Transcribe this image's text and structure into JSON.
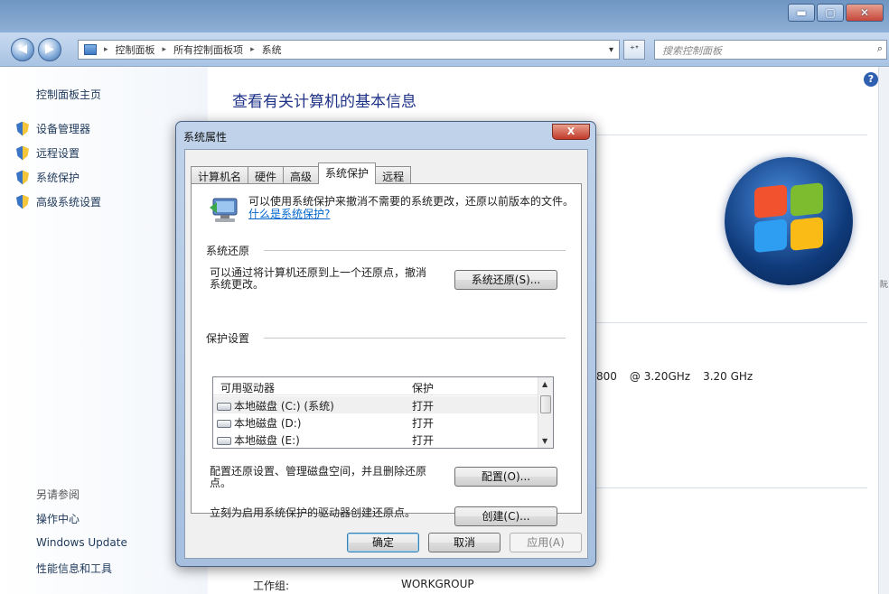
{
  "window": {
    "minimize_glyph": "▬",
    "maximize_glyph": "▢",
    "close_glyph": "✕"
  },
  "address_bar": {
    "back_glyph": "◀",
    "forward_glyph": "▶",
    "crumbs": [
      "控制面板",
      "所有控制面板项",
      "系统"
    ],
    "crumb_separator": "▸",
    "dropdown_glyph": "▾",
    "refresh_glyph": "⁺ᐩ",
    "search_placeholder": "搜索控制面板",
    "search_glyph": "⌕"
  },
  "sidebar": {
    "home": "控制面板主页",
    "tasks": [
      "设备管理器",
      "远程设置",
      "系统保护",
      "高级系统设置"
    ],
    "see_also_title": "另请参阅",
    "see_also": [
      "操作中心",
      "Windows Update",
      "性能信息和工具"
    ]
  },
  "main": {
    "title": "查看有关计算机的基本信息",
    "help_glyph": "?",
    "cpu_model_tail": "800",
    "cpu_speed": "@ 3.20GHz",
    "cpu_speed2": "3.20 GHz",
    "workgroup_label": "工作组:",
    "workgroup_value": "WORKGROUP",
    "edge_glyph": "阮"
  },
  "dialog": {
    "title": "系统属性",
    "close_glyph": "X",
    "tabs": [
      "计算机名",
      "硬件",
      "高级",
      "系统保护",
      "远程"
    ],
    "active_tab": "系统保护",
    "intro_text": "可以使用系统保护来撤消不需要的系统更改，还原以前版本的文件。",
    "intro_link": "什么是系统保护?",
    "restore_group": "系统还原",
    "restore_text": "可以通过将计算机还原到上一个还原点，撤消系统更改。",
    "restore_button": "系统还原(S)...",
    "protect_group": "保护设置",
    "list_headers": [
      "可用驱动器",
      "保护"
    ],
    "drives": [
      {
        "name": "本地磁盘 (C:) (系统)",
        "protection": "打开"
      },
      {
        "name": "本地磁盘 (D:)",
        "protection": "打开"
      },
      {
        "name": "本地磁盘 (E:)",
        "protection": "打开"
      }
    ],
    "configure_text": "配置还原设置、管理磁盘空间，并且删除还原点。",
    "configure_button": "配置(O)...",
    "create_text": "立刻为启用系统保护的驱动器创建还原点。",
    "create_button": "创建(C)...",
    "ok_button": "确定",
    "cancel_button": "取消",
    "apply_button": "应用(A)"
  },
  "colors": {
    "title_bar": "#7a9fca",
    "link": "#0066cc",
    "main_title": "#1e3287"
  }
}
